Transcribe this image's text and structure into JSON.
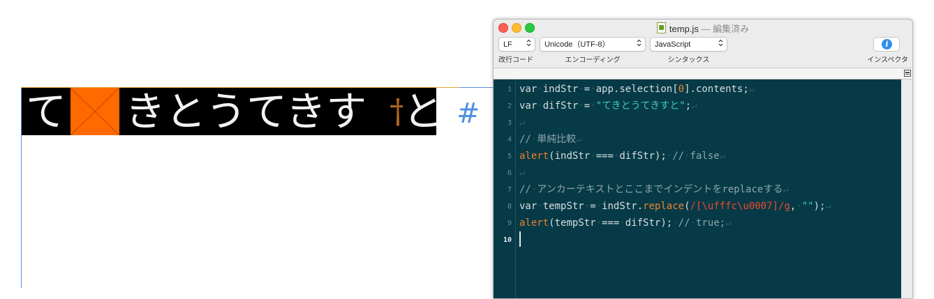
{
  "layout_text": {
    "first_char": "て",
    "rest_text": "きとうてきす",
    "indent_marker": "†",
    "last_char": "と",
    "end_marker": "#"
  },
  "window": {
    "file_name": "temp.js",
    "separator": " — ",
    "status": "編集済み"
  },
  "toolbar": {
    "line_ending": {
      "value": "LF",
      "label": "改行コード"
    },
    "encoding": {
      "value": "Unicode（UTF-8）",
      "label": "エンコーディング"
    },
    "syntax": {
      "value": "JavaScript",
      "label": "シンタックス"
    },
    "inspector": {
      "label": "インスペクタ"
    },
    "updown_glyph": "⌃⌄"
  },
  "editor": {
    "line_numbers": [
      "1",
      "2",
      "3",
      "4",
      "5",
      "6",
      "7",
      "8",
      "9",
      "10"
    ],
    "current_line": "10",
    "lines": [
      [
        {
          "t": "var",
          "c": "kw"
        },
        {
          "t": "·",
          "c": "inv"
        },
        {
          "t": "indStr",
          "c": "kw"
        },
        {
          "t": "·",
          "c": "inv"
        },
        {
          "t": "=",
          "c": "kw"
        },
        {
          "t": "·",
          "c": "inv"
        },
        {
          "t": "app.selection[",
          "c": "kw"
        },
        {
          "t": "0",
          "c": "num"
        },
        {
          "t": "].contents;",
          "c": "kw"
        },
        {
          "t": "↵",
          "c": "inv"
        }
      ],
      [
        {
          "t": "var",
          "c": "kw"
        },
        {
          "t": "·",
          "c": "inv"
        },
        {
          "t": "difStr",
          "c": "kw"
        },
        {
          "t": "·",
          "c": "inv"
        },
        {
          "t": "=",
          "c": "kw"
        },
        {
          "t": "·",
          "c": "inv"
        },
        {
          "t": "\"てきとうてきすと\"",
          "c": "str"
        },
        {
          "t": ";",
          "c": "kw"
        },
        {
          "t": "↵",
          "c": "inv"
        }
      ],
      [
        {
          "t": "↵",
          "c": "inv"
        }
      ],
      [
        {
          "t": "//",
          "c": "cmt"
        },
        {
          "t": "·",
          "c": "inv"
        },
        {
          "t": "単純比較",
          "c": "cmt"
        },
        {
          "t": "↵",
          "c": "inv"
        }
      ],
      [
        {
          "t": "alert",
          "c": "fn"
        },
        {
          "t": "(indStr",
          "c": "kw"
        },
        {
          "t": "·",
          "c": "inv"
        },
        {
          "t": "===",
          "c": "kw"
        },
        {
          "t": "·",
          "c": "inv"
        },
        {
          "t": "difStr);",
          "c": "kw"
        },
        {
          "t": "·",
          "c": "inv"
        },
        {
          "t": "//",
          "c": "cmt"
        },
        {
          "t": "·",
          "c": "inv"
        },
        {
          "t": "false",
          "c": "cmt"
        },
        {
          "t": "↵",
          "c": "inv"
        }
      ],
      [
        {
          "t": "↵",
          "c": "inv"
        }
      ],
      [
        {
          "t": "//",
          "c": "cmt"
        },
        {
          "t": "·",
          "c": "inv"
        },
        {
          "t": "アンカーテキストとここまでインデントをreplaceする",
          "c": "cmt"
        },
        {
          "t": "↵",
          "c": "inv"
        }
      ],
      [
        {
          "t": "var",
          "c": "kw"
        },
        {
          "t": "·",
          "c": "inv"
        },
        {
          "t": "tempStr",
          "c": "kw"
        },
        {
          "t": "·",
          "c": "inv"
        },
        {
          "t": "=",
          "c": "kw"
        },
        {
          "t": "·",
          "c": "inv"
        },
        {
          "t": "indStr.",
          "c": "kw"
        },
        {
          "t": "replace",
          "c": "fn"
        },
        {
          "t": "(",
          "c": "kw"
        },
        {
          "t": "/[\\ufffc\\u0007]/g",
          "c": "rx"
        },
        {
          "t": ",",
          "c": "kw"
        },
        {
          "t": "·",
          "c": "inv"
        },
        {
          "t": "\"\"",
          "c": "str"
        },
        {
          "t": ");",
          "c": "kw"
        },
        {
          "t": "↵",
          "c": "inv"
        }
      ],
      [
        {
          "t": "alert",
          "c": "fn"
        },
        {
          "t": "(tempStr",
          "c": "kw"
        },
        {
          "t": "·",
          "c": "inv"
        },
        {
          "t": "===",
          "c": "kw"
        },
        {
          "t": "·",
          "c": "inv"
        },
        {
          "t": "difStr);",
          "c": "kw"
        },
        {
          "t": "·",
          "c": "inv"
        },
        {
          "t": "//",
          "c": "cmt"
        },
        {
          "t": "·",
          "c": "inv"
        },
        {
          "t": "true;",
          "c": "cmt"
        },
        {
          "t": "↵",
          "c": "inv"
        }
      ],
      []
    ]
  },
  "colors": {
    "editor_bg": "#063a47",
    "keyword": "#d8dee0",
    "function": "#f0812c",
    "string": "#46c9b8",
    "regex": "#f0472f",
    "comment": "#8fa6ab",
    "anchor_fill": "#ff6a00"
  }
}
